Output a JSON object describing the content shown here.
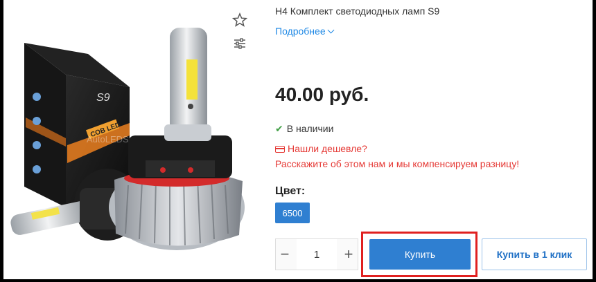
{
  "product": {
    "title": "H4 Комплект светодиодных ламп S9",
    "more_label": "Подробнее",
    "price": "40.00 руб.",
    "availability": "В наличии",
    "cheaper_label": "Нашли дешевле?",
    "compensate_text": "Расскажите об этом нам и мы компенсируем разницу!",
    "color_label": "Цвет:",
    "color_option": "6500",
    "quantity": "1",
    "minus_label": "−",
    "plus_label": "+",
    "buy_label": "Купить",
    "one_click_label": "Купить в 1 клик"
  },
  "image": {
    "box_title": "S9",
    "box_badge": "COB LED",
    "watermark": "AutoLEDShop.by"
  },
  "icons": {
    "favorite": "star-outline-icon",
    "compare": "sliders-icon",
    "availability": "check-icon",
    "cheaper": "credit-card-icon",
    "more": "chevron-down-icon"
  },
  "colors": {
    "accent": "#2f7fd1",
    "link": "#1e88e5",
    "alert": "#e53935",
    "in_stock": "#43a047",
    "highlight": "#e02020"
  }
}
